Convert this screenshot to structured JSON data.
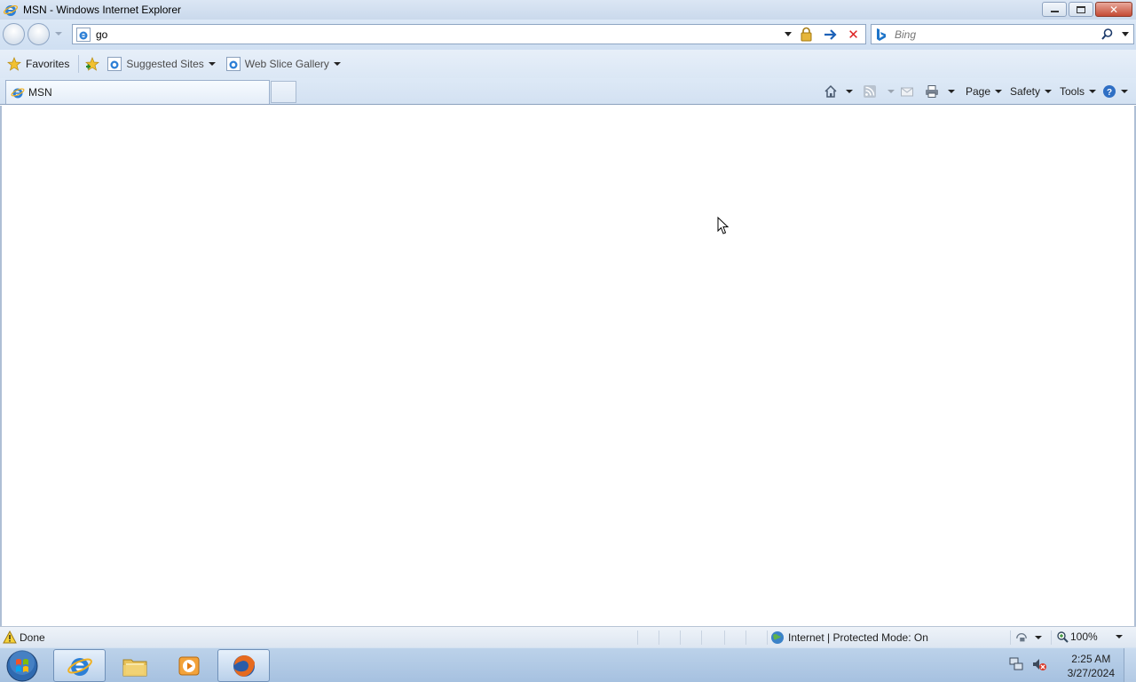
{
  "window": {
    "title": "MSN - Windows Internet Explorer"
  },
  "nav": {
    "address_value": "go",
    "search_placeholder": "Bing"
  },
  "favorites_bar": {
    "favorites_label": "Favorites",
    "suggested_sites_label": "Suggested Sites",
    "web_slice_gallery_label": "Web Slice Gallery"
  },
  "tabs": [
    {
      "label": "MSN"
    }
  ],
  "command_bar": {
    "page_label": "Page",
    "safety_label": "Safety",
    "tools_label": "Tools"
  },
  "status_bar": {
    "status_text": "Done",
    "zone_text": "Internet | Protected Mode: On",
    "zoom_text": "100%"
  },
  "taskbar": {
    "time": "2:25 AM",
    "date": "3/27/2024"
  },
  "colors": {
    "chrome_blue": "#d3e1f2",
    "close_red": "#c44a34",
    "taskbar_blue": "#a6c1e0"
  }
}
